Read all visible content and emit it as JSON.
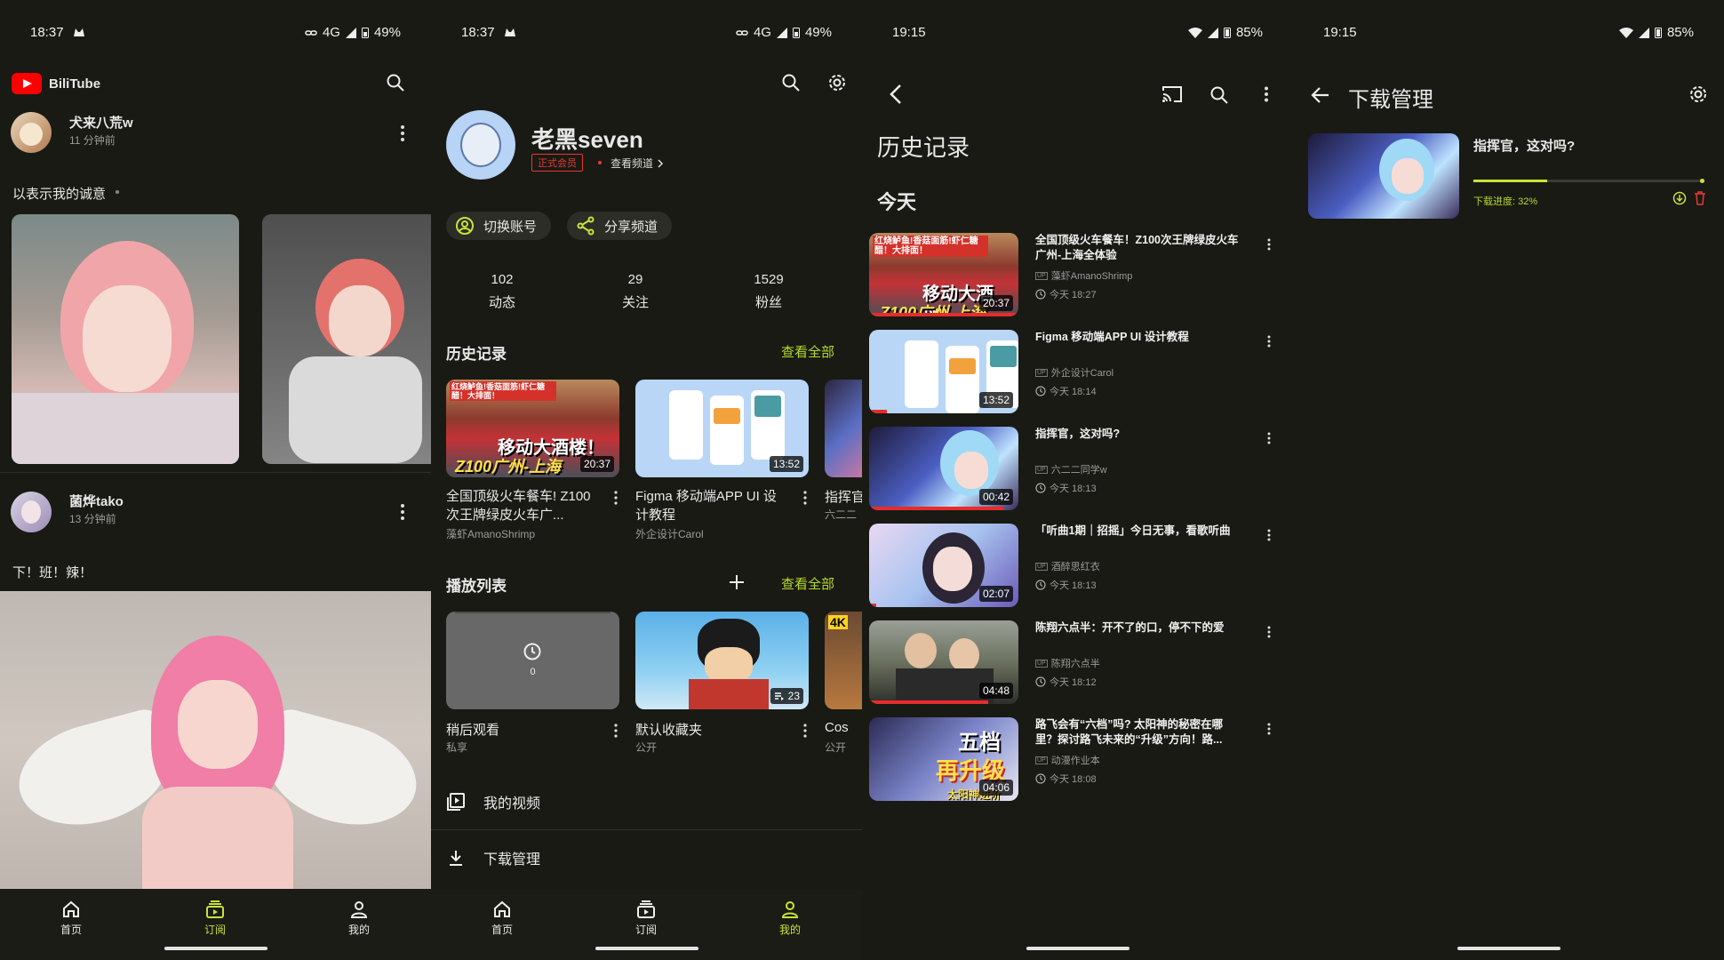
{
  "status": {
    "s1": {
      "time": "18:37",
      "network": "4G",
      "battery": "49%"
    },
    "s2": {
      "time": "18:37",
      "network": "4G",
      "battery": "49%"
    },
    "s3": {
      "time": "19:15",
      "battery": "85%"
    },
    "s4": {
      "time": "19:15",
      "battery": "85%"
    }
  },
  "feed": {
    "app_name": "BiliTube",
    "posts": [
      {
        "author": "犬来八荒w",
        "time": "11 分钟前",
        "text": "以表示我的诚意"
      },
      {
        "author": "菌烨tako",
        "time": "13 分钟前",
        "text": "下！班！辣！"
      }
    ]
  },
  "nav": {
    "home": "首页",
    "subscriptions": "订阅",
    "me": "我的"
  },
  "profile": {
    "username": "老黑seven",
    "member_badge": "正式会员",
    "view_channel": "查看频道",
    "switch_account": "切换账号",
    "share_channel": "分享频道",
    "stats": [
      {
        "value": "102",
        "label": "动态"
      },
      {
        "value": "29",
        "label": "关注"
      },
      {
        "value": "1529",
        "label": "粉丝"
      }
    ],
    "history_title": "历史记录",
    "view_all": "查看全部",
    "history": [
      {
        "title": "全国顶级火车餐车! Z100次王牌绿皮火车广...",
        "channel": "藻虾AmanoShrimp",
        "duration": "20:37",
        "overlay_top": "红烧鲈鱼!香菇面筋!虾仁糖醋！大排面！",
        "overlay_mid": "移动大酒楼！",
        "overlay_bottom": "Z100广州-上海"
      },
      {
        "title": "Figma 移动端APP UI 设计教程",
        "channel": "外企设计Carol",
        "duration": "13:52"
      },
      {
        "title": "指挥官",
        "channel": "六二二"
      }
    ],
    "playlist_title": "播放列表",
    "playlists": [
      {
        "title": "稍后观看",
        "privacy": "私享",
        "count": "0"
      },
      {
        "title": "默认收藏夹",
        "privacy": "公开",
        "count": "23"
      },
      {
        "title": "Cos",
        "privacy": "公开",
        "badge": "4K"
      }
    ],
    "my_videos": "我的视频",
    "downloads": "下载管理"
  },
  "history_page": {
    "title": "历史记录",
    "section": "今天",
    "items": [
      {
        "title": "全国顶级火车餐车！Z100次王牌绿皮火车广州-上海全体验",
        "channel": "藻虾AmanoShrimp",
        "time": "今天 18:27",
        "duration": "20:37",
        "progress": 1.0,
        "overlay_top": "红烧鲈鱼!香菇面筋!虾仁糖醋！大排面！",
        "overlay_mid": "移动大酒楼！",
        "overlay_bottom": "Z100广州-上海"
      },
      {
        "title": "Figma 移动端APP UI 设计教程",
        "channel": "外企设计Carol",
        "time": "今天 18:14",
        "duration": "13:52",
        "progress": 0.12
      },
      {
        "title": "指挥官，这对吗?",
        "channel": "六二二同学w",
        "time": "今天 18:13",
        "duration": "00:42",
        "progress": 0.9
      },
      {
        "title": "「听曲1期｜招摇」今日无事，看歌听曲",
        "channel": "酒醉思红衣",
        "time": "今天 18:13",
        "duration": "02:07",
        "progress": 0.05
      },
      {
        "title": "陈翔六点半：开不了的口，停不下的爱",
        "channel": "陈翔六点半",
        "time": "今天 18:12",
        "duration": "04:48",
        "progress": 0.8
      },
      {
        "title": "路飞会有“六档”吗? 太阳神的秘密在哪里？探讨路飞未来的“升级”方向！路...",
        "channel": "动漫作业本",
        "time": "今天 18:08",
        "duration": "04:06",
        "progress": 0.0,
        "overlay_1": "五档",
        "overlay_2": "再升级",
        "overlay_3": "太阳神进阶"
      }
    ]
  },
  "downloads_page": {
    "title": "下载管理",
    "items": [
      {
        "title": "指挥官，这对吗?",
        "progress_label": "下载进度: 32%",
        "progress": 0.32
      }
    ]
  },
  "colors": {
    "accent": "#c7e33a",
    "bg": "#191a14",
    "progress_red": "#e82b2b",
    "badge_red": "#e53935"
  }
}
